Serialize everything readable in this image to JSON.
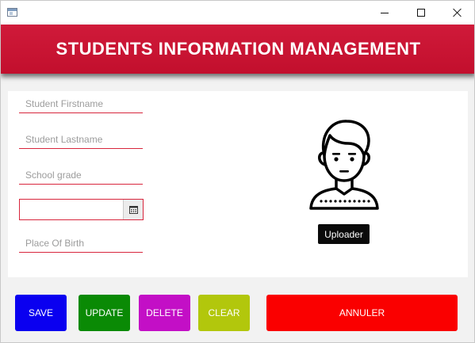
{
  "window": {
    "controls": {
      "minimize_icon": "minimize-icon",
      "maximize_icon": "maximize-icon",
      "close_icon": "close-icon"
    }
  },
  "header": {
    "title": "STUDENTS INFORMATION MANAGEMENT",
    "color": "#c8142f"
  },
  "form": {
    "firstname": {
      "placeholder": "Student Firstname",
      "value": ""
    },
    "lastname": {
      "placeholder": "Student Lastname",
      "value": ""
    },
    "grade": {
      "placeholder": "School grade",
      "value": ""
    },
    "birthdate": {
      "value": "",
      "icon": "calendar-icon"
    },
    "birthplace": {
      "placeholder": "Place Of Birth",
      "value": ""
    },
    "accent_color": "#d8263d"
  },
  "photo": {
    "icon": "student-avatar-icon",
    "upload_label": "Uploader"
  },
  "actions": {
    "save": {
      "label": "SAVE",
      "color": "#0a00f0"
    },
    "update": {
      "label": "UPDATE",
      "color": "#0a8a05"
    },
    "delete": {
      "label": "DELETE",
      "color": "#c30fc6"
    },
    "clear": {
      "label": "CLEAR",
      "color": "#b2c70c"
    },
    "cancel": {
      "label": "ANNULER",
      "color": "#fa0000"
    }
  }
}
